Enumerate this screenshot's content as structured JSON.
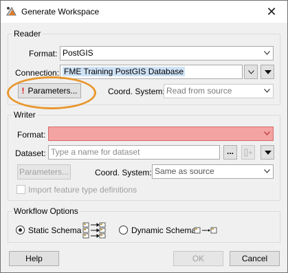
{
  "window": {
    "title": "Generate Workspace"
  },
  "reader": {
    "legend": "Reader",
    "format_label": "Format:",
    "format_value": "PostGIS",
    "connection_label": "Connection:",
    "connection_value": "FME Training PostGIS Database",
    "parameters_label": "Parameters...",
    "coord_label": "Coord. System:",
    "coord_value": "Read from source"
  },
  "writer": {
    "legend": "Writer",
    "format_label": "Format:",
    "format_value": "",
    "dataset_label": "Dataset:",
    "dataset_placeholder": "Type a name for dataset",
    "browse_label": "...",
    "parameters_label": "Parameters...",
    "coord_label": "Coord. System:",
    "coord_value": "Same as source",
    "import_label": "Import feature type definitions"
  },
  "workflow": {
    "legend": "Workflow Options",
    "static_label": "Static Schema",
    "dynamic_label": "Dynamic Schema",
    "selected": "Static Schema"
  },
  "buttons": {
    "help": "Help",
    "ok": "OK",
    "cancel": "Cancel"
  },
  "colors": {
    "highlight_ring": "#e8972e",
    "error_field": "#f4a3a3",
    "warning": "#dd1111"
  }
}
